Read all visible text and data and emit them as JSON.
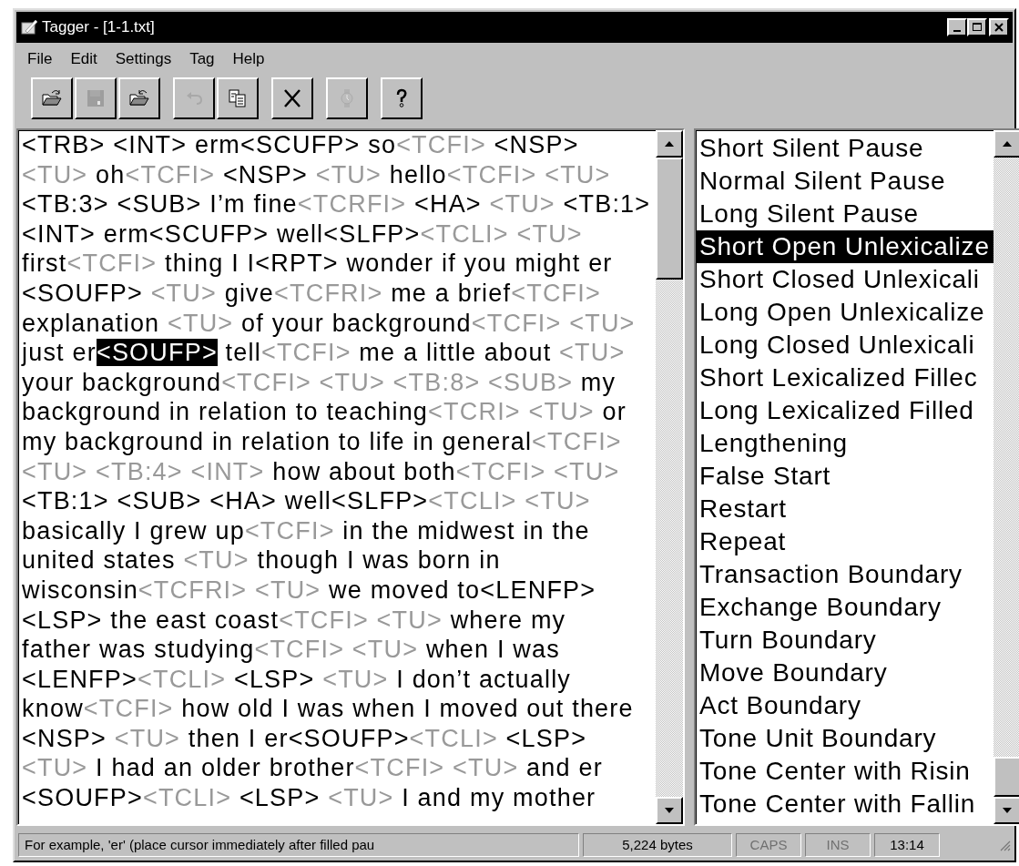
{
  "window": {
    "title": "Tagger - [1-1.txt]"
  },
  "menu": [
    "File",
    "Edit",
    "Settings",
    "Tag",
    "Help"
  ],
  "toolbar": [
    [
      {
        "kind": "open",
        "disabled": false
      },
      {
        "kind": "save",
        "disabled": true
      },
      {
        "kind": "reopen",
        "disabled": false
      }
    ],
    [
      {
        "kind": "undo",
        "disabled": true
      },
      {
        "kind": "copy",
        "disabled": false
      }
    ],
    [
      {
        "kind": "delete",
        "disabled": false
      }
    ],
    [
      {
        "kind": "watch",
        "disabled": true
      }
    ],
    [
      {
        "kind": "help",
        "disabled": false
      }
    ]
  ],
  "editor": {
    "lines": [
      [
        {
          "t": "<TRB> <INT> erm<SCUFP> so",
          "kind": "plain"
        },
        {
          "t": "<TCFI>",
          "kind": "dim"
        },
        {
          "t": " <NSP>",
          "kind": "plain"
        }
      ],
      [
        {
          "t": "<TU>",
          "kind": "dim"
        },
        {
          "t": " oh",
          "kind": "plain"
        },
        {
          "t": "<TCFI>",
          "kind": "dim"
        },
        {
          "t": " <NSP> ",
          "kind": "plain"
        },
        {
          "t": "<TU>",
          "kind": "dim"
        },
        {
          "t": " hello",
          "kind": "plain"
        },
        {
          "t": "<TCFI> <TU>",
          "kind": "dim"
        }
      ],
      [
        {
          "t": "<TB:3> <SUB> I’m fine",
          "kind": "plain"
        },
        {
          "t": "<TCRFI>",
          "kind": "dim"
        },
        {
          "t": " <HA> ",
          "kind": "plain"
        },
        {
          "t": "<TU>",
          "kind": "dim"
        },
        {
          "t": " <TB:1>",
          "kind": "plain"
        }
      ],
      [
        {
          "t": "<INT> erm<SCUFP> well<SLFP>",
          "kind": "plain"
        },
        {
          "t": "<TCLI> <TU>",
          "kind": "dim"
        }
      ],
      [
        {
          "t": "first",
          "kind": "plain"
        },
        {
          "t": "<TCFI>",
          "kind": "dim"
        },
        {
          "t": " thing I I<RPT> wonder if you might er",
          "kind": "plain"
        }
      ],
      [
        {
          "t": "<SOUFP> ",
          "kind": "plain"
        },
        {
          "t": "<TU>",
          "kind": "dim"
        },
        {
          "t": " give",
          "kind": "plain"
        },
        {
          "t": "<TCFRI>",
          "kind": "dim"
        },
        {
          "t": " me a brief",
          "kind": "plain"
        },
        {
          "t": "<TCFI>",
          "kind": "dim"
        }
      ],
      [
        {
          "t": "explanation ",
          "kind": "plain"
        },
        {
          "t": "<TU>",
          "kind": "dim"
        },
        {
          "t": " of your background",
          "kind": "plain"
        },
        {
          "t": "<TCFI> <TU>",
          "kind": "dim"
        }
      ],
      [
        {
          "t": "just er",
          "kind": "plain"
        },
        {
          "t": "<SOUFP>",
          "kind": "selected"
        },
        {
          "t": " tell",
          "kind": "plain"
        },
        {
          "t": "<TCFI>",
          "kind": "dim"
        },
        {
          "t": " me a little about ",
          "kind": "plain"
        },
        {
          "t": "<TU>",
          "kind": "dim"
        }
      ],
      [
        {
          "t": "your background",
          "kind": "plain"
        },
        {
          "t": "<TCFI> <TU> <TB:8> <SUB>",
          "kind": "dim"
        },
        {
          "t": " my",
          "kind": "plain"
        }
      ],
      [
        {
          "t": "background in relation to teaching",
          "kind": "plain"
        },
        {
          "t": "<TCRI> <TU>",
          "kind": "dim"
        },
        {
          "t": " or",
          "kind": "plain"
        }
      ],
      [
        {
          "t": "my background in relation to life in general",
          "kind": "plain"
        },
        {
          "t": "<TCFI>",
          "kind": "dim"
        }
      ],
      [
        {
          "t": "<TU> <TB:4> <INT>",
          "kind": "dim"
        },
        {
          "t": " how about both",
          "kind": "plain"
        },
        {
          "t": "<TCFI> <TU>",
          "kind": "dim"
        }
      ],
      [
        {
          "t": "<TB:1> <SUB> <HA> well<SLFP>",
          "kind": "plain"
        },
        {
          "t": "<TCLI> <TU>",
          "kind": "dim"
        }
      ],
      [
        {
          "t": "basically I grew up",
          "kind": "plain"
        },
        {
          "t": "<TCFI>",
          "kind": "dim"
        },
        {
          "t": " in the midwest in the",
          "kind": "plain"
        }
      ],
      [
        {
          "t": "united states ",
          "kind": "plain"
        },
        {
          "t": "<TU>",
          "kind": "dim"
        },
        {
          "t": " though I was born in",
          "kind": "plain"
        }
      ],
      [
        {
          "t": "wisconsin",
          "kind": "plain"
        },
        {
          "t": "<TCFRI> <TU>",
          "kind": "dim"
        },
        {
          "t": " we moved to<LENFP>",
          "kind": "plain"
        }
      ],
      [
        {
          "t": "<LSP> the east coast",
          "kind": "plain"
        },
        {
          "t": "<TCFI> <TU>",
          "kind": "dim"
        },
        {
          "t": " where my",
          "kind": "plain"
        }
      ],
      [
        {
          "t": "father was studying",
          "kind": "plain"
        },
        {
          "t": "<TCFI> <TU>",
          "kind": "dim"
        },
        {
          "t": " when I was",
          "kind": "plain"
        }
      ],
      [
        {
          "t": "<LENFP>",
          "kind": "plain"
        },
        {
          "t": "<TCLI>",
          "kind": "dim"
        },
        {
          "t": " <LSP> ",
          "kind": "plain"
        },
        {
          "t": "<TU>",
          "kind": "dim"
        },
        {
          "t": " I don’t actually",
          "kind": "plain"
        }
      ],
      [
        {
          "t": "know",
          "kind": "plain"
        },
        {
          "t": "<TCFI>",
          "kind": "dim"
        },
        {
          "t": " how old I was when I moved out there",
          "kind": "plain"
        }
      ],
      [
        {
          "t": "<NSP> ",
          "kind": "plain"
        },
        {
          "t": "<TU>",
          "kind": "dim"
        },
        {
          "t": " then I er<SOUFP>",
          "kind": "plain"
        },
        {
          "t": "<TCLI>",
          "kind": "dim"
        },
        {
          "t": " <LSP>",
          "kind": "plain"
        }
      ],
      [
        {
          "t": "<TU>",
          "kind": "dim"
        },
        {
          "t": " I had an older brother",
          "kind": "plain"
        },
        {
          "t": "<TCFI> <TU>",
          "kind": "dim"
        },
        {
          "t": " and er",
          "kind": "plain"
        }
      ],
      [
        {
          "t": "<SOUFP>",
          "kind": "plain"
        },
        {
          "t": "<TCLI>",
          "kind": "dim"
        },
        {
          "t": " <LSP> ",
          "kind": "plain"
        },
        {
          "t": "<TU>",
          "kind": "dim"
        },
        {
          "t": " I and my mother",
          "kind": "plain"
        }
      ]
    ]
  },
  "tag_list": [
    {
      "label": "Short Silent Pause",
      "selected": false
    },
    {
      "label": "Normal Silent Pause",
      "selected": false
    },
    {
      "label": "Long Silent Pause",
      "selected": false
    },
    {
      "label": "Short Open Unlexicalize",
      "selected": true
    },
    {
      "label": "Short Closed Unlexicali",
      "selected": false
    },
    {
      "label": "Long Open Unlexicalize",
      "selected": false
    },
    {
      "label": "Long Closed Unlexicali",
      "selected": false
    },
    {
      "label": "Short Lexicalized Fillec",
      "selected": false
    },
    {
      "label": "Long Lexicalized Filled",
      "selected": false
    },
    {
      "label": "Lengthening",
      "selected": false
    },
    {
      "label": "False Start",
      "selected": false
    },
    {
      "label": "Restart",
      "selected": false
    },
    {
      "label": "Repeat",
      "selected": false
    },
    {
      "label": "Transaction Boundary",
      "selected": false
    },
    {
      "label": "Exchange Boundary",
      "selected": false
    },
    {
      "label": "Turn Boundary",
      "selected": false
    },
    {
      "label": "Move Boundary",
      "selected": false
    },
    {
      "label": "Act Boundary",
      "selected": false
    },
    {
      "label": "Tone Unit Boundary",
      "selected": false
    },
    {
      "label": "Tone Center with Risin",
      "selected": false
    },
    {
      "label": "Tone Center with Fallin",
      "selected": false
    }
  ],
  "status_bar": [
    {
      "text": "For example, 'er' (place cursor immediately after filled pau",
      "kind": "message",
      "disabled": false
    },
    {
      "text": "5,224 bytes",
      "kind": "size",
      "disabled": false
    },
    {
      "text": "CAPS",
      "kind": "key",
      "disabled": true
    },
    {
      "text": "INS",
      "kind": "key",
      "disabled": true
    },
    {
      "text": "13:14",
      "kind": "key",
      "disabled": false
    }
  ]
}
